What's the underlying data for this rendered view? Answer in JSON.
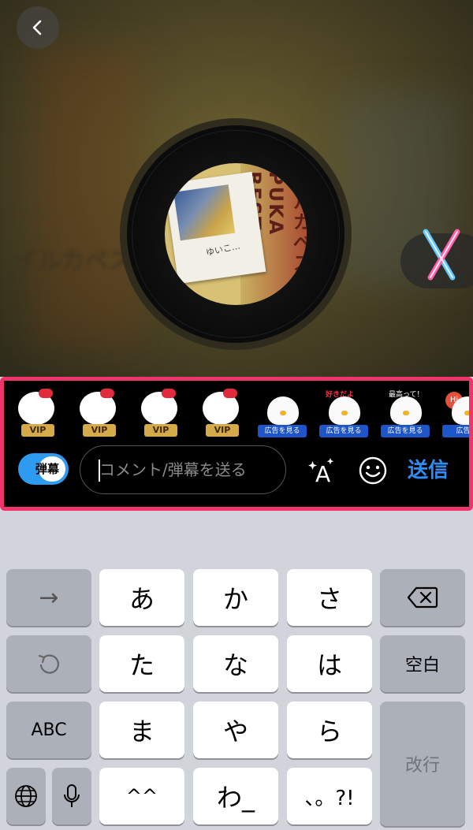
{
  "player": {
    "background_text": "イルカベス",
    "background_text_top": "",
    "album_spine_text": "イルカベスト PUKA BEST",
    "cover_caption": "ゆいこ…"
  },
  "comment_panel": {
    "stamps": [
      {
        "kind": "kitty",
        "badge": "VIP"
      },
      {
        "kind": "kitty",
        "badge": "VIP"
      },
      {
        "kind": "kitty",
        "badge": "VIP"
      },
      {
        "kind": "kitty",
        "badge": "VIP"
      },
      {
        "kind": "chick",
        "badge": "広告を見る",
        "bubble": ""
      },
      {
        "kind": "chick",
        "badge": "広告を見る",
        "bubble": "好きだよ"
      },
      {
        "kind": "chick",
        "badge": "広告を見る",
        "bubble": "最高って！"
      },
      {
        "kind": "chick",
        "badge": "広告を",
        "bubble": "Hi"
      }
    ],
    "danmaku_toggle_label": "弾幕",
    "input_placeholder": "コメント/弾幕を送る",
    "input_value": "",
    "send_label": "送信"
  },
  "keyboard": {
    "row1": [
      "→",
      "あ",
      "か",
      "さ",
      "delete"
    ],
    "row2": [
      "undo",
      "た",
      "な",
      "は",
      "空白"
    ],
    "row3": [
      "ABC",
      "ま",
      "や",
      "ら",
      "改行"
    ],
    "row4": [
      "globe",
      "mic",
      "^^",
      "わ_",
      "、。?!"
    ]
  },
  "colors": {
    "accent_blue": "#2f8cf4",
    "highlight_border": "#f0336b",
    "vip_gold": "#d6a94a",
    "ad_blue": "#1e55c8"
  }
}
